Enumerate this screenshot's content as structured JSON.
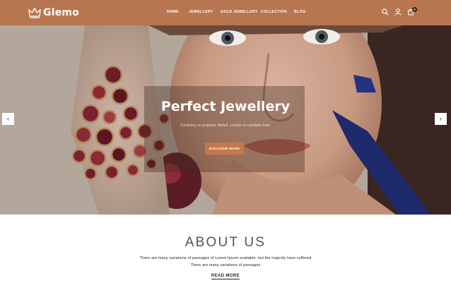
{
  "brand": {
    "name": "Glemo",
    "icon": "crown-icon"
  },
  "nav": {
    "items": [
      {
        "label": "HOME"
      },
      {
        "label": "JEWELLERY"
      },
      {
        "label": "GOLD JEWELLERY"
      },
      {
        "label": "COLLECTION"
      },
      {
        "label": "BLOG"
      }
    ]
  },
  "header_icons": {
    "search": "search-icon",
    "account": "user-icon",
    "cart": "cart-icon",
    "cart_count": "0"
  },
  "hero": {
    "title": "Perfect Jewellery",
    "subtitle": "Contrary to popular belief, Lorem is random text.",
    "button_label": "DISCOVER MORE",
    "prev_icon": "‹",
    "next_icon": "›"
  },
  "about": {
    "title": "ABOUT US",
    "line1": "There are many variations of passages of Lorem Ipsum available, but the majority have suffered",
    "line2": "There are many variations of passages",
    "link_label": "READ MORE"
  },
  "colors": {
    "header_bg": "#b7764f",
    "accent_button": "#c5784d",
    "white": "#ffffff"
  }
}
